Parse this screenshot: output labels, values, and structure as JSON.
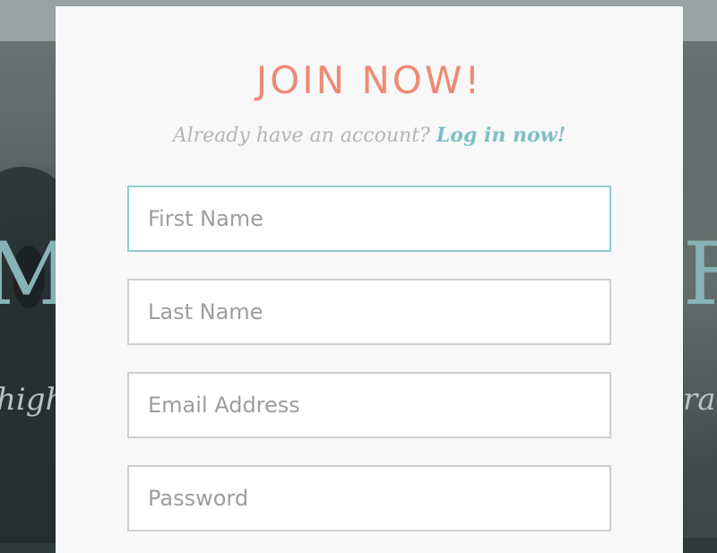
{
  "modal": {
    "title": "JOIN NOW!",
    "subtitle_prefix": "Already have an account? ",
    "login_link": "Log in now!"
  },
  "form": {
    "first_name_placeholder": "First Name",
    "last_name_placeholder": "Last Name",
    "email_placeholder": "Email Address",
    "password_placeholder": "Password"
  },
  "background": {
    "heading_left_fragment": "M",
    "heading_right_fragment": "F",
    "tagline_left_fragment": "high",
    "tagline_right_fragment": "ra"
  },
  "colors": {
    "title": "#ee8a74",
    "link": "#7dbfc2",
    "focus_border": "#8fcccd"
  }
}
